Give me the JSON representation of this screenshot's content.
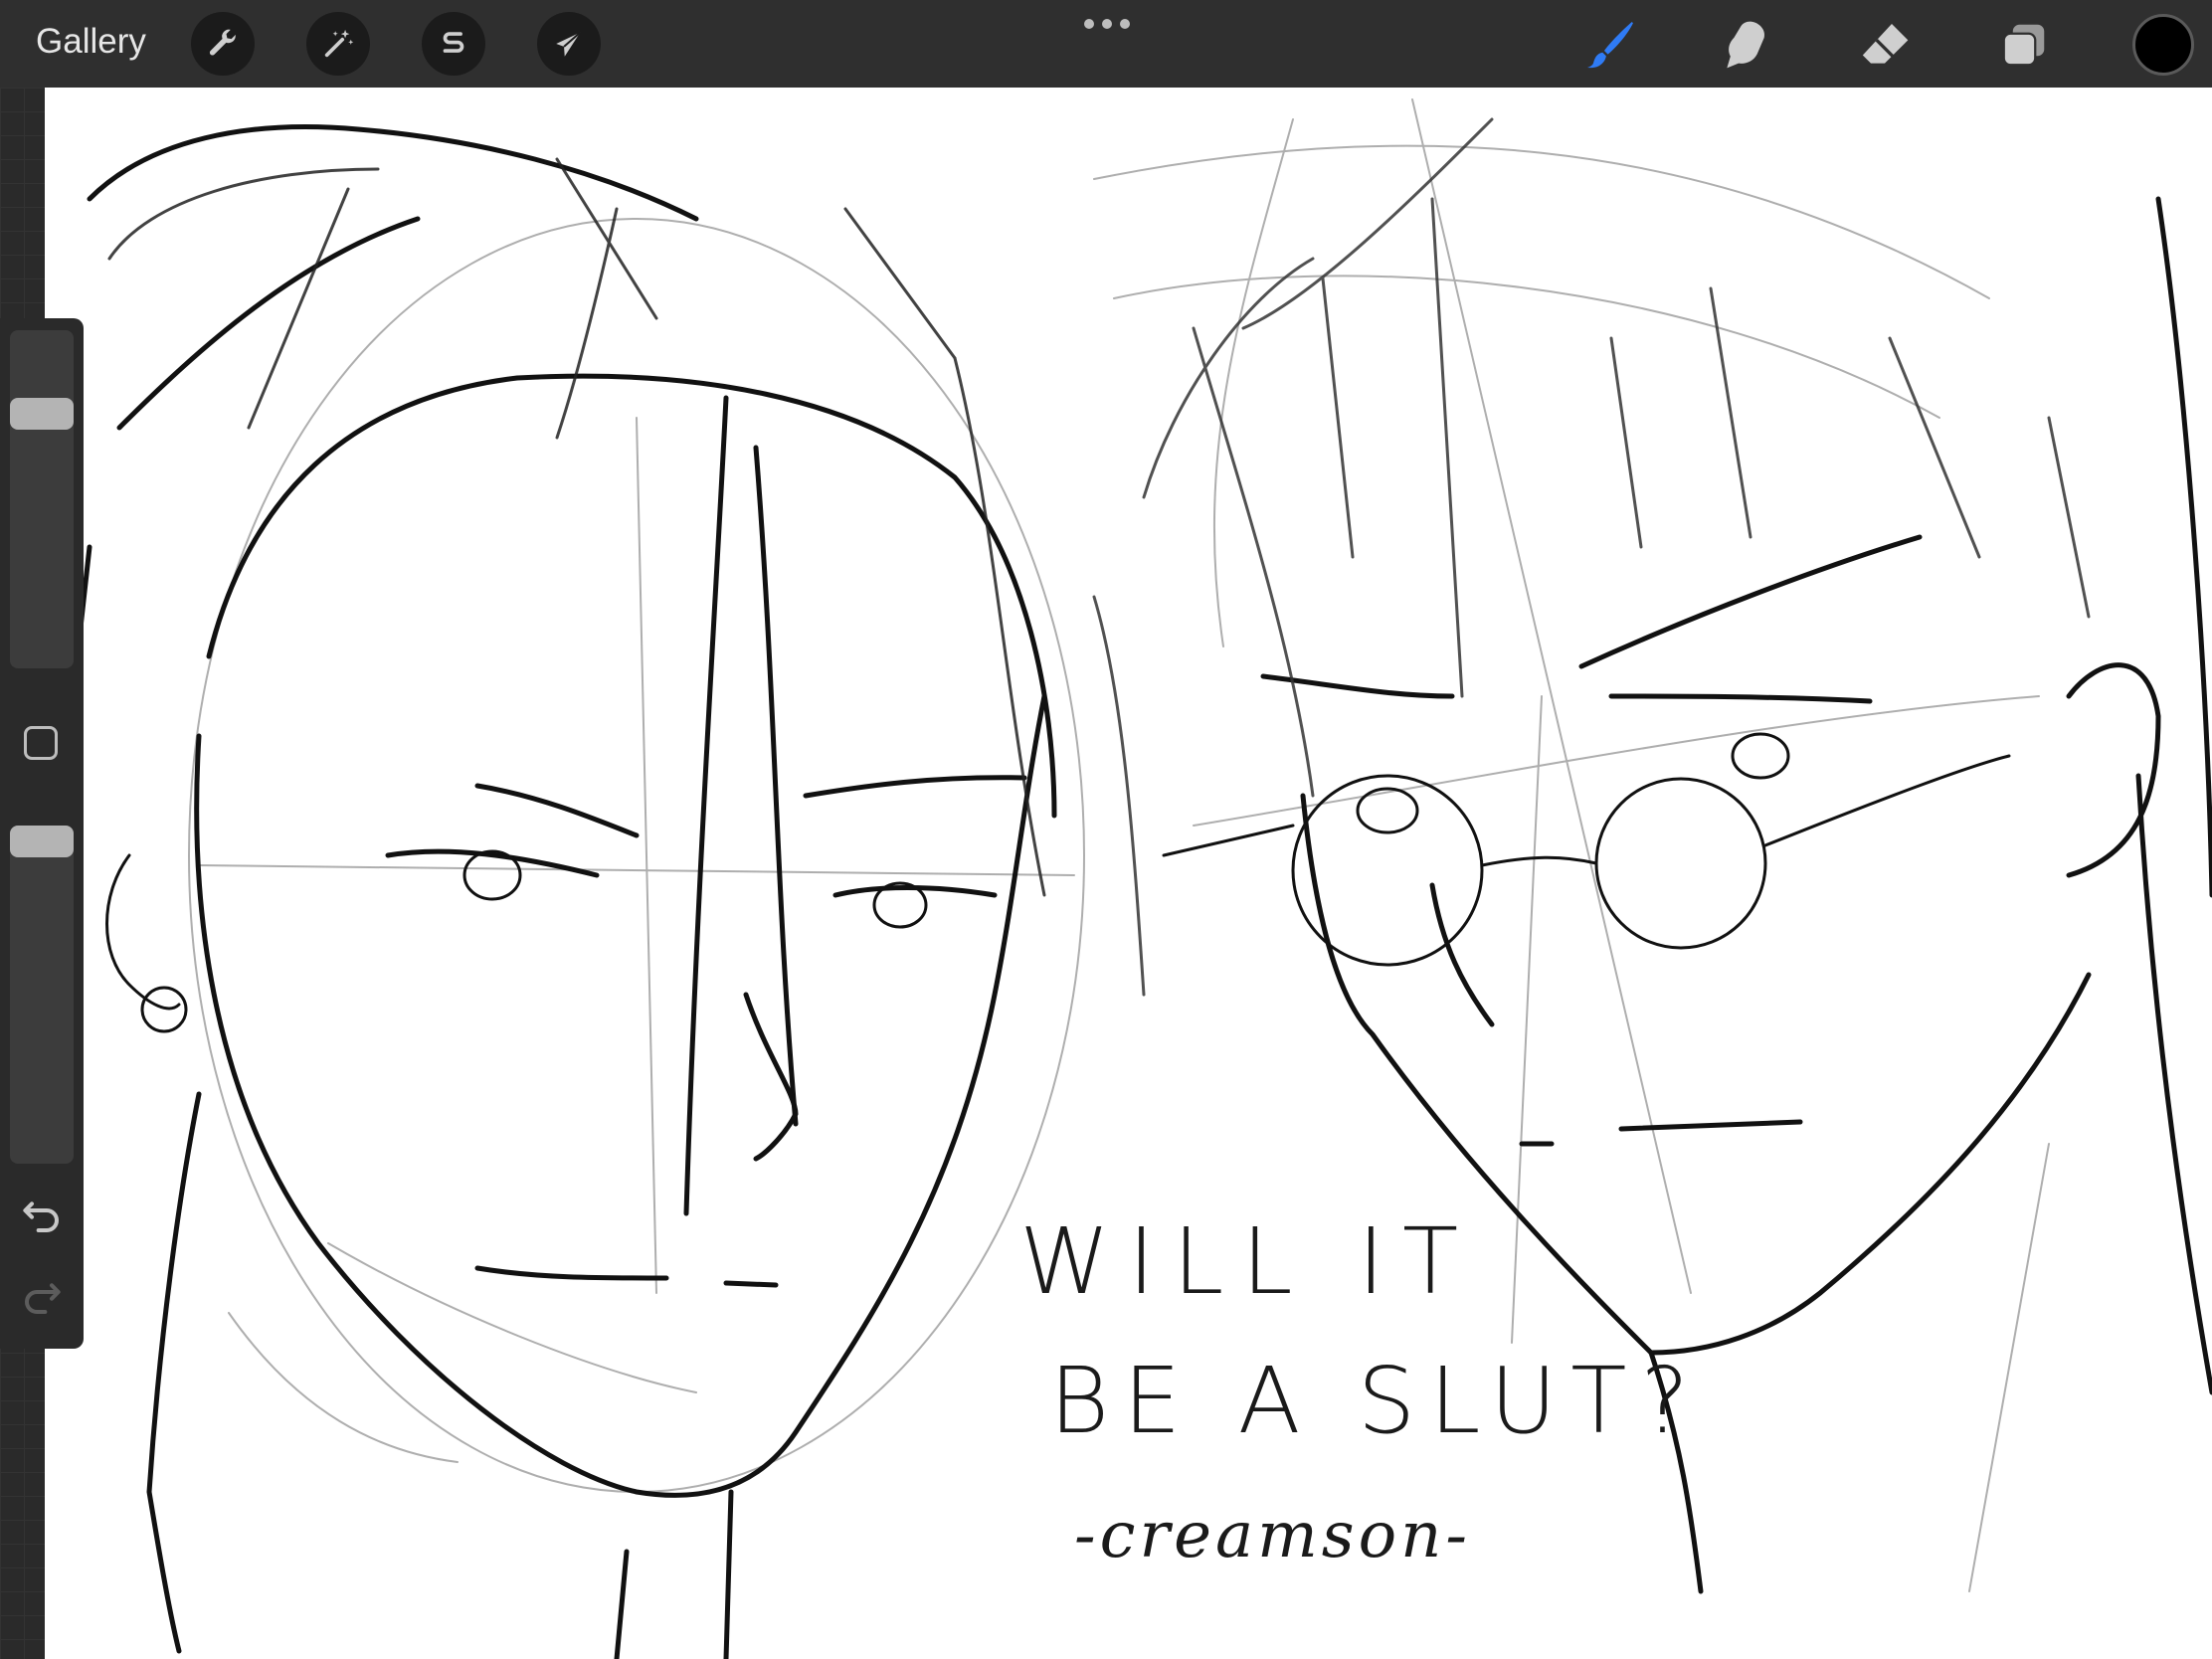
{
  "app": {
    "gallery_label": "Gallery"
  },
  "toolbar": {
    "left_tools": [
      {
        "name": "actions",
        "icon": "wrench-icon"
      },
      {
        "name": "adjustments",
        "icon": "magic-wand-icon"
      },
      {
        "name": "selection",
        "icon": "selection-s-icon"
      },
      {
        "name": "transform",
        "icon": "arrow-cursor-icon"
      }
    ],
    "right_tools": [
      {
        "name": "brush",
        "icon": "brush-icon",
        "active": true
      },
      {
        "name": "smudge",
        "icon": "smudge-finger-icon",
        "active": false
      },
      {
        "name": "eraser",
        "icon": "eraser-icon",
        "active": false
      },
      {
        "name": "layers",
        "icon": "layers-icon",
        "active": false
      }
    ],
    "active_color": "#000000",
    "accent_color": "#2f7bf5"
  },
  "sidebar": {
    "brush_size_level": 0.78,
    "brush_opacity_level": 1.0,
    "undo_icon": "undo-arrow-icon",
    "redo_icon": "redo-arrow-icon",
    "modifier_icon": "square-modifier-icon"
  },
  "canvas": {
    "handwritten_text": {
      "line1": "WILL IT",
      "line2": "BE A SLUT?",
      "signature": "-creamson-"
    }
  }
}
